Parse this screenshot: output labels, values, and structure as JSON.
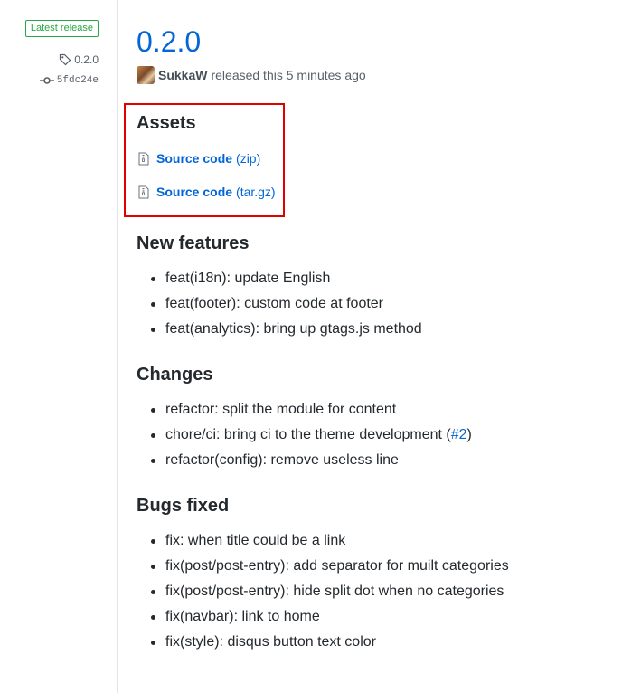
{
  "sidebar": {
    "badge": "Latest release",
    "tag": "0.2.0",
    "commit": "5fdc24e"
  },
  "release": {
    "title": "0.2.0",
    "author": "SukkaW",
    "released_text": "released this 5 minutes ago"
  },
  "assets": {
    "title": "Assets",
    "items": [
      {
        "name": "Source code",
        "ext": "(zip)"
      },
      {
        "name": "Source code",
        "ext": "(tar.gz)"
      }
    ]
  },
  "sections": [
    {
      "title": "New features",
      "items": [
        "feat(i18n): update English",
        "feat(footer): custom code at footer",
        "feat(analytics): bring up gtags.js method"
      ]
    },
    {
      "title": "Changes",
      "items": [
        "refactor: split the module for content",
        "chore/ci: bring ci to the theme development (",
        "refactor(config): remove useless line"
      ],
      "issue_link": "#2",
      "issue_suffix": ")"
    },
    {
      "title": "Bugs fixed",
      "items": [
        "fix: when title could be a link",
        "fix(post/post-entry): add separator for muilt categories",
        "fix(post/post-entry): hide split dot when no categories",
        "fix(navbar): link to home",
        "fix(style): disqus button text color"
      ]
    }
  ],
  "icons": {
    "tag": "tag-icon",
    "commit": "git-commit-icon",
    "archive": "file-zip-icon"
  },
  "colors": {
    "link": "#0366d6",
    "badge_green": "#28a745",
    "highlight_red": "#e00000"
  }
}
